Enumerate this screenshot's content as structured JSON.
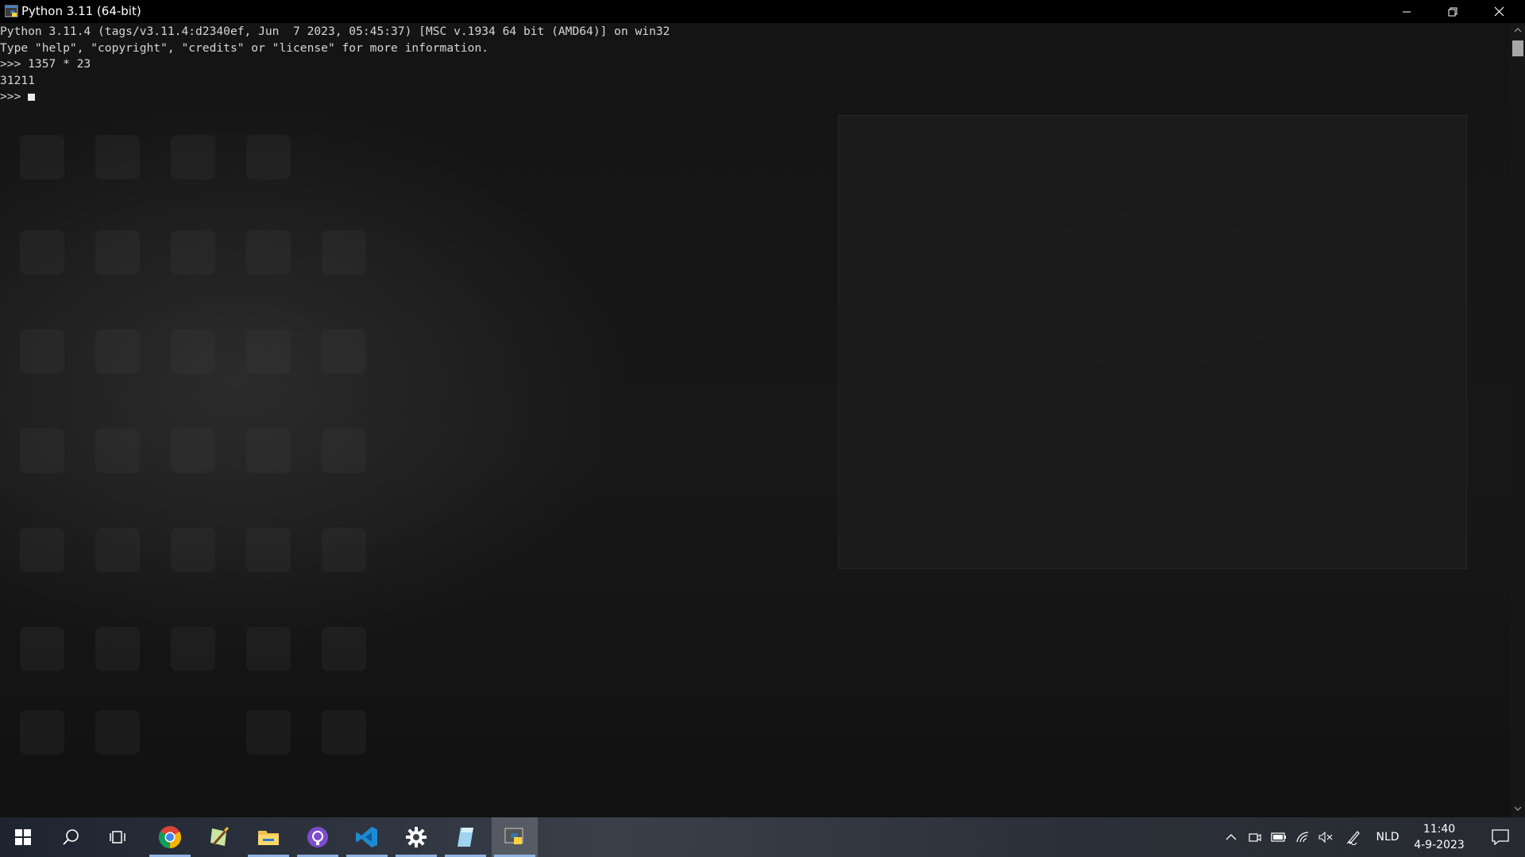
{
  "window": {
    "title": "Python 3.11 (64-bit)"
  },
  "console": {
    "lines": [
      "Python 3.11.4 (tags/v3.11.4:d2340ef, Jun  7 2023, 05:45:37) [MSC v.1934 64 bit (AMD64)] on win32",
      "Type \"help\", \"copyright\", \"credits\" or \"license\" for more information.",
      ">>> 1357 * 23",
      "31211",
      ">>> "
    ]
  },
  "taskbar": {
    "apps": [
      {
        "name": "Google Chrome",
        "icon": "chrome-icon"
      },
      {
        "name": "Notepad++",
        "icon": "notepad-plus-icon"
      },
      {
        "name": "File Explorer",
        "icon": "file-explorer-icon"
      },
      {
        "name": "GitHub Desktop",
        "icon": "github-icon"
      },
      {
        "name": "Visual Studio Code",
        "icon": "vscode-icon"
      },
      {
        "name": "Settings",
        "icon": "gear-icon"
      },
      {
        "name": "Notepad",
        "icon": "notepad-icon"
      },
      {
        "name": "Python",
        "icon": "python-icon"
      }
    ],
    "language": "NLD",
    "time": "11:40",
    "date": "4-9-2023"
  },
  "colors": {
    "console_text": "#d6d6d6",
    "titlebar_bg": "#000000",
    "running_indicator": "#8fb4e3"
  }
}
